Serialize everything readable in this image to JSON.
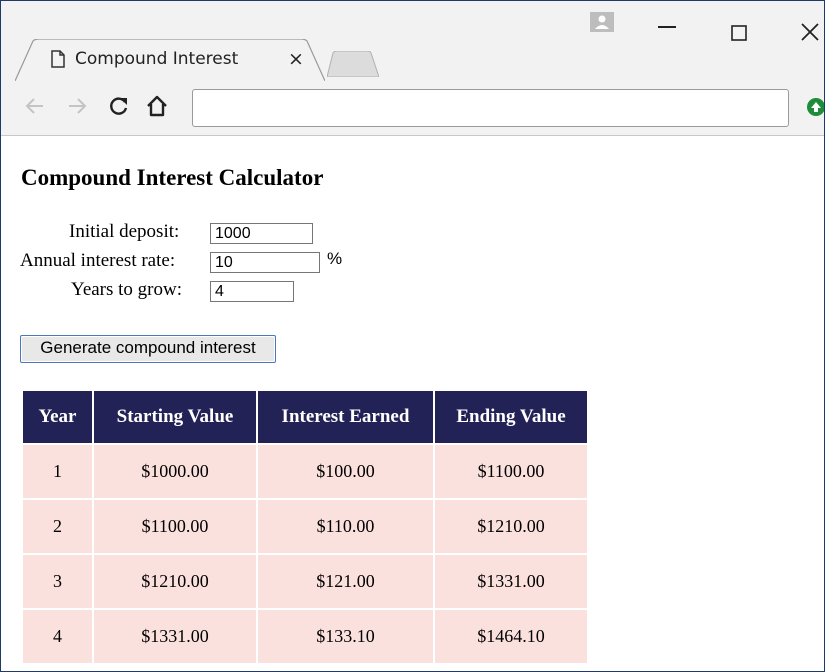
{
  "browser": {
    "tab_title": "Compound Interest",
    "tab_close": "×",
    "icons": [
      "page-icon",
      "back-icon",
      "forward-icon",
      "reload-icon",
      "home-icon",
      "profile-icon",
      "minimize-icon",
      "maximize-icon",
      "close-icon",
      "extension-icon"
    ],
    "address_value": ""
  },
  "page": {
    "title": "Compound Interest Calculator",
    "form": {
      "deposit_label": "Initial deposit:",
      "deposit_value": "1000",
      "rate_label": "Annual interest rate:",
      "rate_value": "10",
      "rate_unit": "%",
      "years_label": "Years to grow:",
      "years_value": "4"
    },
    "generate_button": "Generate compound interest",
    "table": {
      "headers": [
        "Year",
        "Starting Value",
        "Interest Earned",
        "Ending Value"
      ],
      "rows": [
        [
          "1",
          "$1000.00",
          "$100.00",
          "$1100.00"
        ],
        [
          "2",
          "$1100.00",
          "$110.00",
          "$1210.00"
        ],
        [
          "3",
          "$1210.00",
          "$121.00",
          "$1331.00"
        ],
        [
          "4",
          "$1331.00",
          "$133.10",
          "$1464.10"
        ]
      ]
    }
  },
  "colors": {
    "header_bg": "#232256",
    "row_bg": "#fbe1de",
    "window_border": "#1f3a68",
    "extension_green": "#1e8c3a"
  }
}
